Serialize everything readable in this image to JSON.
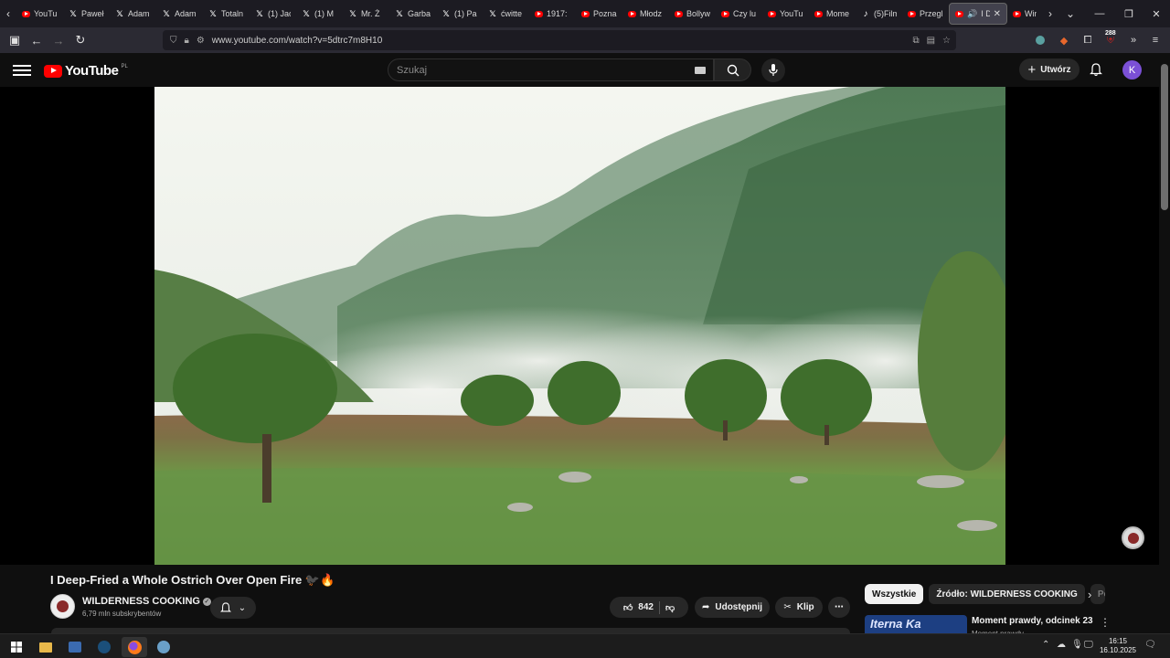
{
  "browser": {
    "tabs": [
      {
        "icon": "youtube-icon",
        "label": "YouTu"
      },
      {
        "icon": "x-icon",
        "label": "Paweł"
      },
      {
        "icon": "x-icon",
        "label": "Adam"
      },
      {
        "icon": "x-icon",
        "label": "Adam"
      },
      {
        "icon": "x-icon",
        "label": "Totaln"
      },
      {
        "icon": "x-icon",
        "label": "(1) Jac"
      },
      {
        "icon": "x-icon",
        "label": "(1) M"
      },
      {
        "icon": "x-icon",
        "label": "Mr. Ż"
      },
      {
        "icon": "x-icon",
        "label": "Garba"
      },
      {
        "icon": "x-icon",
        "label": "(1) Pa"
      },
      {
        "icon": "x-icon",
        "label": "ćwitte"
      },
      {
        "icon": "youtube-icon",
        "label": "1917:"
      },
      {
        "icon": "youtube-icon",
        "label": "Pozna"
      },
      {
        "icon": "youtube-icon",
        "label": "Młodz"
      },
      {
        "icon": "youtube-icon",
        "label": "Bollyw"
      },
      {
        "icon": "youtube-icon",
        "label": "Czy lu"
      },
      {
        "icon": "youtube-icon",
        "label": "YouTu"
      },
      {
        "icon": "youtube-icon",
        "label": "Mome"
      },
      {
        "icon": "tiktok-icon",
        "label": "(5)Film"
      },
      {
        "icon": "youtube-icon",
        "label": "Przegl"
      }
    ],
    "active_tab": {
      "label": "I De"
    },
    "after_tab": {
      "label": "Win"
    },
    "url": "www.youtube.com/watch?v=5dtrc7m8H10",
    "extension_badge": "288"
  },
  "youtube": {
    "logo_text": "YouTube",
    "region": "PL",
    "search_placeholder": "Szukaj",
    "create_label": "Utwórz",
    "avatar_letter": "K",
    "video": {
      "title": "I Deep-Fried a Whole Ostrich Over Open Fire 🐦‍⬛🔥",
      "channel": "WILDERNESS COOKING",
      "subscribers": "6,79 mln subskrybentów",
      "likes": "842",
      "share_label": "Udostępnij",
      "clip_label": "Klip"
    },
    "chips": [
      "Wszystkie",
      "Źródło: WILDERNESS COOKING",
      "Po"
    ],
    "recommendation": {
      "title": "Moment prawdy, odcinek 23",
      "subtitle": "Moment prawdy",
      "thumb_text": "Iterna Ka"
    }
  },
  "taskbar": {
    "time": "16:15",
    "date": "16.10.2025"
  }
}
